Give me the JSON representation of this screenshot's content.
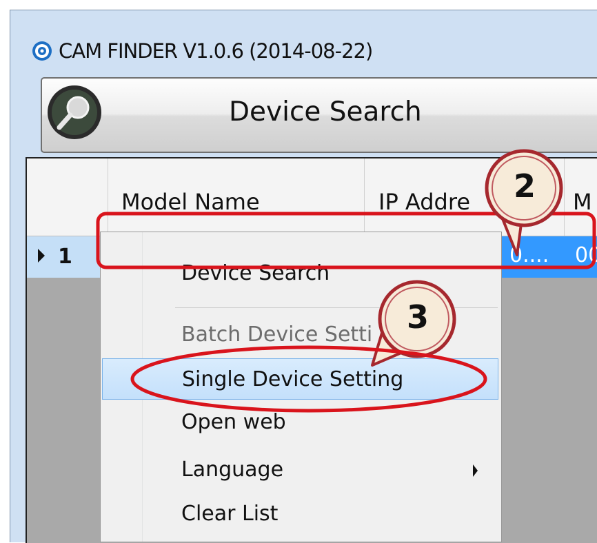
{
  "window": {
    "title": "CAM FINDER V1.0.6 (2014-08-22)"
  },
  "toolbar": {
    "search_label": "Device Search"
  },
  "grid": {
    "columns": [
      {
        "label": "Model Name"
      },
      {
        "label": "IP Addre"
      },
      {
        "label": "M"
      }
    ],
    "rows": [
      {
        "number": "1",
        "ip_fragment": "0....",
        "mac_fragment": "00"
      }
    ]
  },
  "context_menu": {
    "items": [
      {
        "label": "Device Search",
        "state": "normal"
      },
      {
        "label": "Batch Device Setti",
        "state": "disabled"
      },
      {
        "label": "Single Device Setting",
        "state": "highlighted"
      },
      {
        "label": "Open web",
        "state": "normal"
      },
      {
        "label": "Language",
        "state": "normal",
        "has_submenu": true
      },
      {
        "label": "Clear List",
        "state": "normal"
      }
    ]
  },
  "annotations": {
    "step_a": "2",
    "step_b": "3"
  },
  "colors": {
    "accent_red": "#d9141c",
    "selection_blue": "#3399ff",
    "callout_fill": "#f7ebd9"
  }
}
